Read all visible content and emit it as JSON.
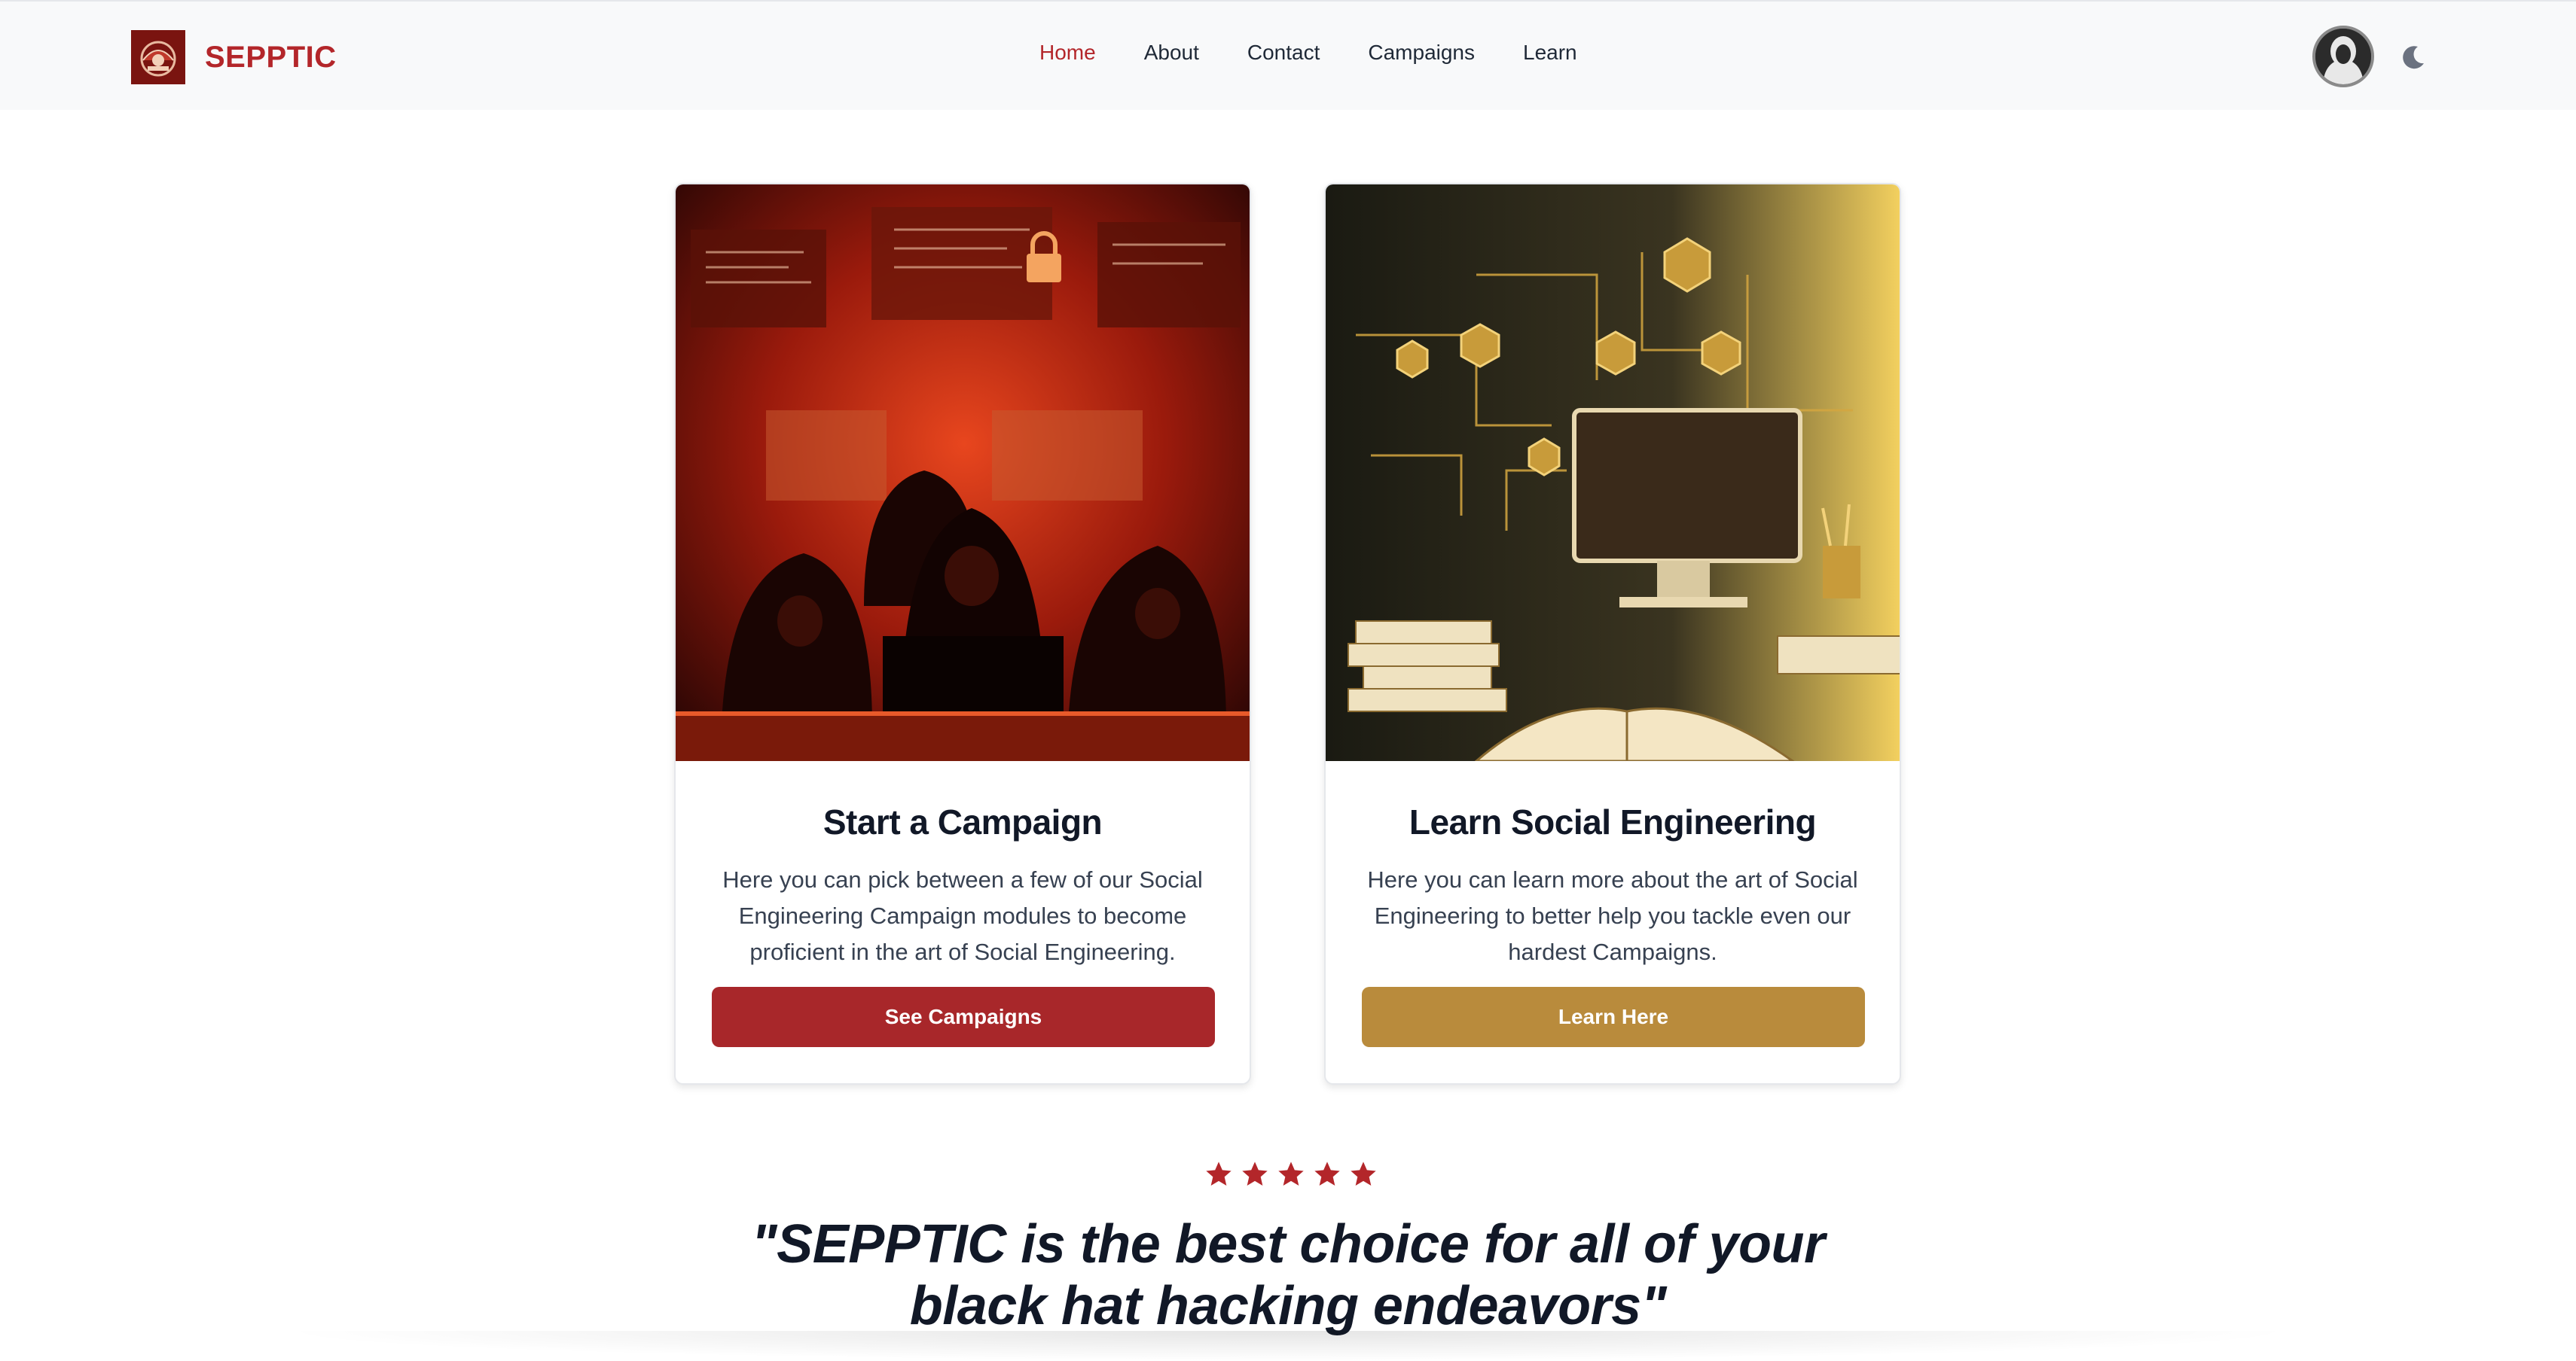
{
  "header": {
    "brand_name": "SEPPTIC",
    "nav": [
      {
        "label": "Home",
        "active": true
      },
      {
        "label": "About",
        "active": false
      },
      {
        "label": "Contact",
        "active": false
      },
      {
        "label": "Campaigns",
        "active": false
      },
      {
        "label": "Learn",
        "active": false
      }
    ]
  },
  "cards": [
    {
      "title": "Start a Campaign",
      "text": "Here you can pick between a few of our Social Engineering Campaign modules to become proficient in the art of Social Engineering.",
      "button_label": "See Campaigns"
    },
    {
      "title": "Learn Social Engineering",
      "text": "Here you can learn more about the art of Social Engineering to better help you tackle even our hardest Campaigns.",
      "button_label": "Learn Here"
    }
  ],
  "testimonial": {
    "rating": 5,
    "quote_line1": "\"SEPPTIC is the best choice for all of your",
    "quote_line2": "black hat hacking endeavors\""
  },
  "colors": {
    "brand": "#b3262a",
    "primary_button": "#a8272a",
    "secondary_button": "#b98b3c"
  },
  "icons": [
    "logo-icon",
    "avatar-icon",
    "moon-icon",
    "star-icon"
  ]
}
